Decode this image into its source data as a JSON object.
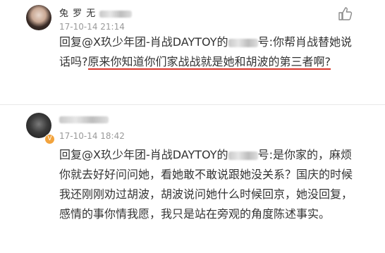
{
  "comments": [
    {
      "username_visible": "兔 罗 无",
      "timestamp": "17-10-14 21:14",
      "reply_prefix": "回复",
      "mention": "@X玖少年团-肖战DAYTOY的",
      "mention_tail": "号",
      "text_before": ":你帮肖战替她说话吗?",
      "text_highlight": "原来你知道你们家战战就是她和胡波的第三者啊?"
    },
    {
      "badge": "V",
      "timestamp": "17-10-14 18:42",
      "reply_prefix": "回复",
      "mention": "@X玖少年团-肖战DAYTOY的",
      "mention_tail": "号",
      "text": ":是你家的，麻烦你就去好好问问她，看她敢不敢说跟她没关系？国庆的时候我还刚刚劝过胡波，胡波说问她什么时候回京，她没回复，感情的事你情我愿，我只是站在旁观的角度陈述事实。"
    }
  ],
  "icons": {
    "like": "thumbs-up-icon"
  },
  "colors": {
    "highlight_underline": "#d9342b",
    "timestamp": "#9a9a9a",
    "badge": "#f2a33c"
  }
}
